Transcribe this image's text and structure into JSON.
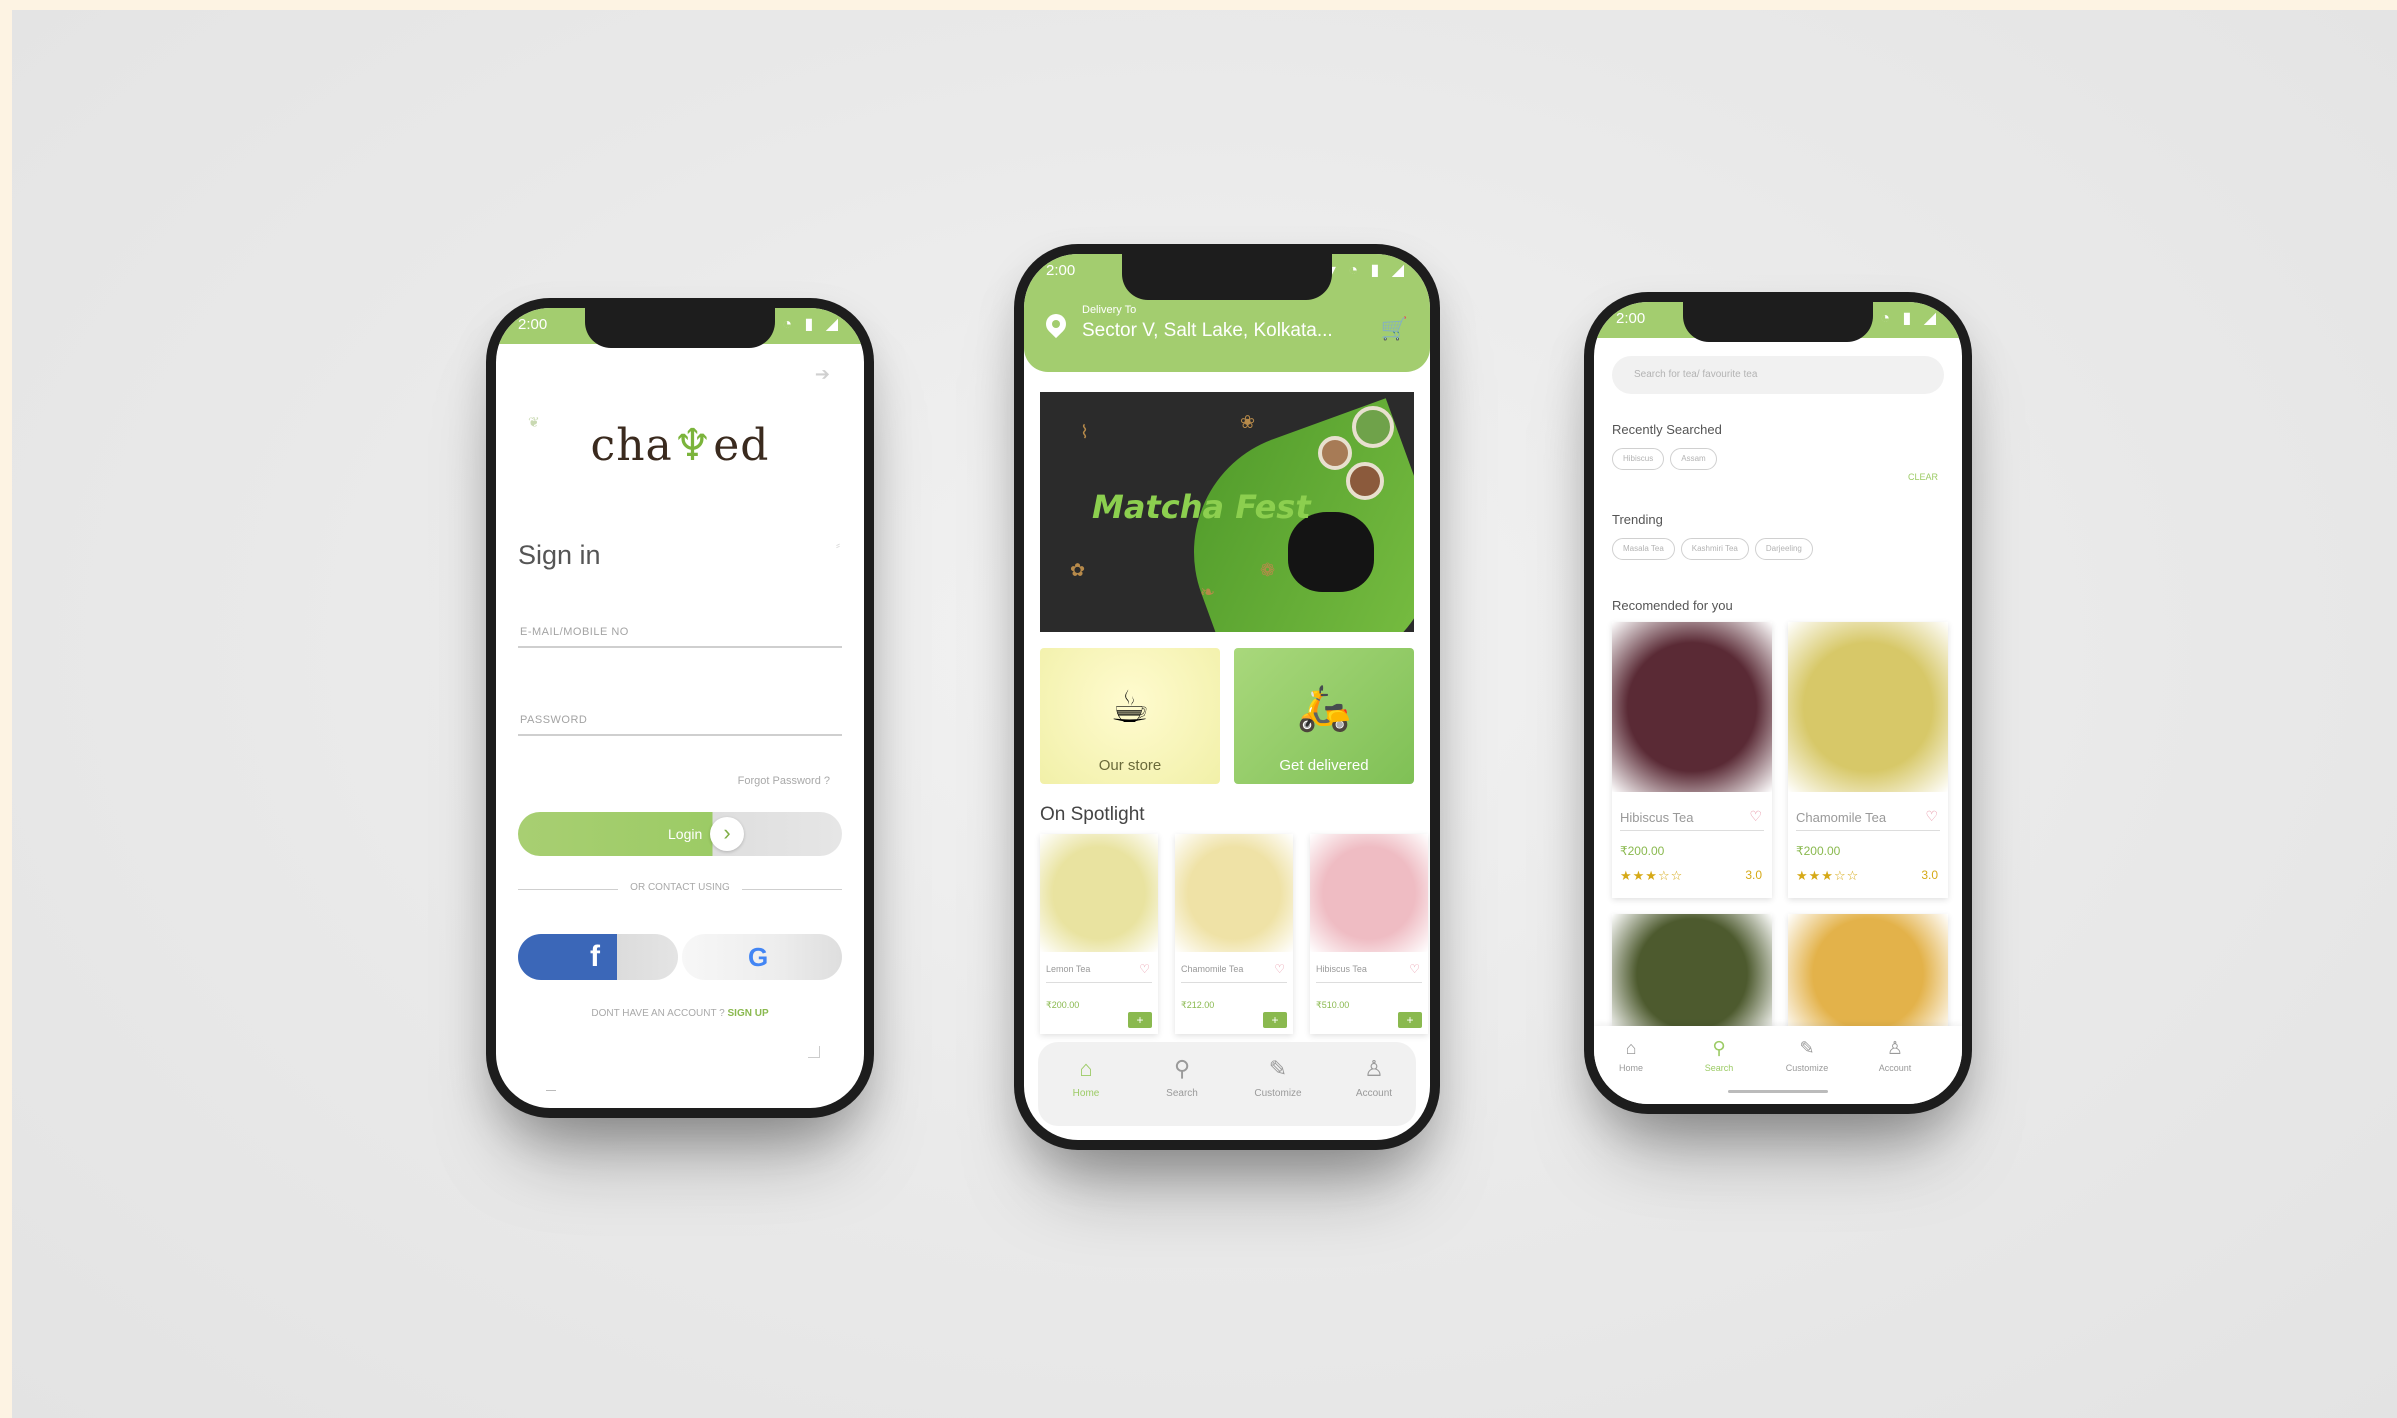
{
  "status": {
    "time": "2:00",
    "icons": "▾ ◔ ▮ ◢"
  },
  "signin": {
    "logo_pre": "cha",
    "logo_leaf": "♆",
    "logo_post": "ed",
    "title": "Sign in",
    "email_placeholder": "E-MAIL/MOBILE NO",
    "password_placeholder": "PASSWORD",
    "forgot": "Forgot Password ?",
    "login_label": "Login",
    "or_text": "OR CONTACT USING",
    "signup_prompt": "DONT HAVE AN ACCOUNT ?",
    "signup_link": "SIGN UP",
    "facebook_glyph": "f",
    "google_glyph": "G"
  },
  "home": {
    "delivery_label": "Delivery To",
    "delivery_address": "Sector V, Salt Lake, Kolkata...",
    "banner_title": "Matcha Fest",
    "tiles": [
      {
        "label": "Our store",
        "icon": "☕"
      },
      {
        "label": "Get delivered",
        "icon": "🛵"
      }
    ],
    "spotlight_title": "On Spotlight",
    "products": [
      {
        "name": "Lemon Tea",
        "price": "₹200.00",
        "color": "#e9e3a0"
      },
      {
        "name": "Chamomile Tea",
        "price": "₹212.00",
        "color": "#efe2a6"
      },
      {
        "name": "Hibiscus Tea",
        "price": "₹510.00",
        "color": "#efbcc3"
      }
    ],
    "add_symbol": "+",
    "heart_symbol": "♡"
  },
  "nav": [
    {
      "label": "Home",
      "icon": "⌂"
    },
    {
      "label": "Search",
      "icon": "⚲"
    },
    {
      "label": "Customize",
      "icon": "✎"
    },
    {
      "label": "Account",
      "icon": "♙"
    }
  ],
  "search": {
    "placeholder": "Search for tea/ favourite tea",
    "recently_title": "Recently Searched",
    "recent_chips": [
      "Hibiscus",
      "Assam"
    ],
    "clear_label": "CLEAR",
    "trending_title": "Trending",
    "trending_chips": [
      "Masala Tea",
      "Kashmiri Tea",
      "Darjeeling"
    ],
    "recommended_title": "Recomended for you",
    "recommended": [
      {
        "name": "Hibiscus Tea",
        "price": "₹200.00",
        "stars": "★★★☆☆",
        "rating": "3.0",
        "color": "#5a2a35"
      },
      {
        "name": "Chamomile Tea",
        "price": "₹200.00",
        "stars": "★★★☆☆",
        "rating": "3.0",
        "color": "#d7c868"
      }
    ],
    "more_colors": [
      "#4d5a2e",
      "#e3b24a"
    ]
  }
}
